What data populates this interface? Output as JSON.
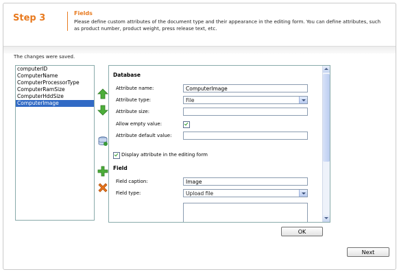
{
  "header": {
    "step_label": "Step 3",
    "title": "Fields",
    "description": "Please define custom attributes of the document type and their appearance in the editing form. You can define attributes, such as product number, product weight, press release text, etc."
  },
  "status_message": "The changes were saved.",
  "attributes_list": {
    "items": [
      "computerID",
      "ComputerName",
      "ComputerProcessorType",
      "ComputerRamSize",
      "ComputerHddSize",
      "ComputerImage"
    ],
    "selected": "ComputerImage"
  },
  "toolbar": {
    "move_up_icon": "arrow-up-icon",
    "move_down_icon": "arrow-down-icon",
    "db_icon": "database-icon",
    "add_icon": "plus-icon",
    "delete_icon": "x-icon"
  },
  "form": {
    "database_section": "Database",
    "attribute_name_label": "Attribute name:",
    "attribute_name_value": "ComputerImage",
    "attribute_type_label": "Attribute type:",
    "attribute_type_value": "File",
    "attribute_size_label": "Attribute size:",
    "attribute_size_value": "",
    "allow_empty_label": "Allow empty value:",
    "allow_empty_checked": true,
    "default_value_label": "Attribute default value:",
    "default_value_value": "",
    "display_in_form_label": "Display attribute in the editing form",
    "display_in_form_checked": true,
    "field_section": "Field",
    "field_caption_label": "Field caption:",
    "field_caption_value": "Image",
    "field_type_label": "Field type:",
    "field_type_value": "Upload file"
  },
  "buttons": {
    "ok": "OK",
    "next": "Next"
  },
  "colors": {
    "accent": "#e87a1f",
    "selection": "#316ac5"
  }
}
